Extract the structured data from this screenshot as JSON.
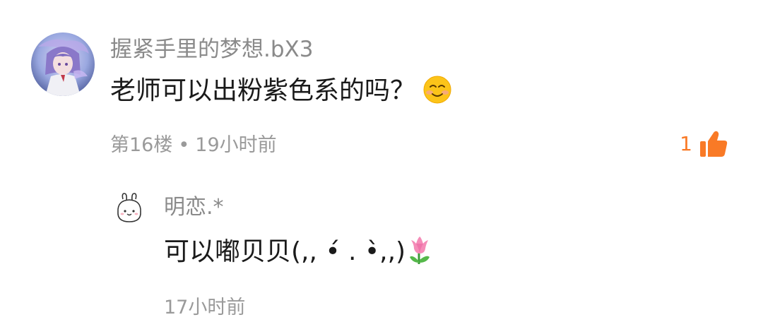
{
  "comment": {
    "username": "握紧手里的梦想.bX3",
    "text": "老师可以出粉紫色系的吗？",
    "emoji": "smiling-face-icon",
    "floor": "第16楼",
    "separator": "•",
    "time": "19小时前",
    "like_count": "1",
    "like_icon": "thumbs-up-icon"
  },
  "reply": {
    "username": "明恋.*",
    "text": "可以嘟贝贝(,, •́ .  •̀,,)",
    "emoji": "tulip-icon",
    "time": "17小时前"
  },
  "colors": {
    "username_gray": "#8a8a8a",
    "meta_gray": "#9a9a9a",
    "like_orange": "#f97a26",
    "text": "#1a1a1a"
  }
}
